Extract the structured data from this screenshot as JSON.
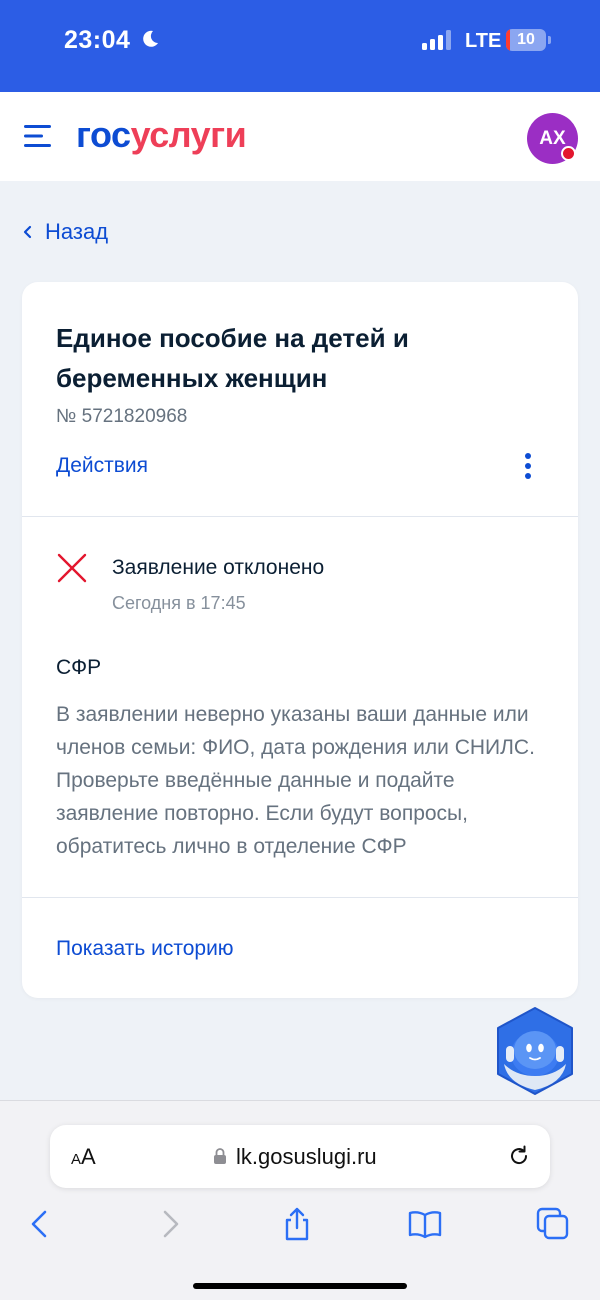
{
  "status_bar": {
    "time": "23:04",
    "network": "LTE",
    "battery_level": "10",
    "battery_fraction": 0.1
  },
  "header": {
    "logo_part1": "гос",
    "logo_part2": "услуги",
    "avatar_initials": "АХ"
  },
  "back_label": "Назад",
  "application": {
    "title": "Единое пособие на детей и беременных женщин",
    "number": "№ 5721820968",
    "actions_label": "Действия",
    "status": {
      "title": "Заявление отклонено",
      "time": "Сегодня в 17:45"
    },
    "organization": "СФР",
    "reason": "В заявлении неверно указаны ваши данные или членов семьи: ФИО, дата рождения или СНИЛС. Проверьте введённые данные и подайте заявление повторно. Если будут вопросы, обратитесь лично в отделение СФР",
    "history_label": "Показать историю"
  },
  "browser": {
    "text_size_small": "A",
    "text_size_large": "A",
    "url": "lk.gosuslugi.ru"
  },
  "colors": {
    "status_bar": "#2c5de5",
    "brand_blue": "#0d4cd3",
    "brand_red": "#ee3f58",
    "reject_red": "#e3162e",
    "background": "#eef2f7"
  },
  "icons": [
    "moon-icon",
    "signal-icon",
    "menu-icon",
    "chevron-left-icon",
    "kebab-icon",
    "reject-cross-icon",
    "robot-assistant-icon",
    "lock-icon",
    "reload-icon",
    "back-arrow-icon",
    "forward-arrow-icon",
    "share-icon",
    "bookmarks-icon",
    "tabs-icon"
  ]
}
